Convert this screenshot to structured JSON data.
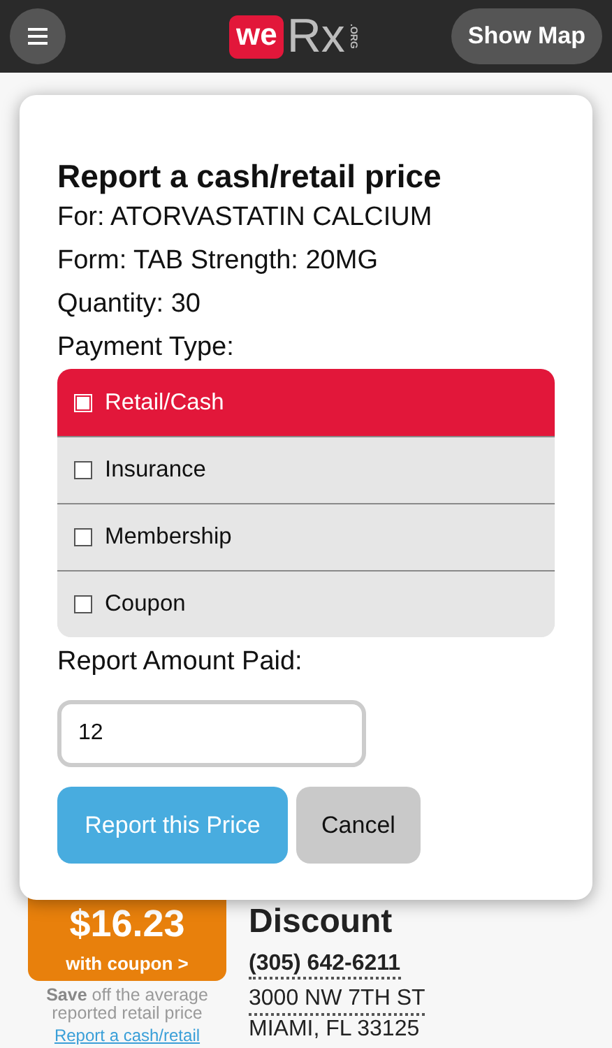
{
  "header": {
    "logo": {
      "we": "we",
      "rx": "Rx",
      "org": ".ORG"
    },
    "show_map": "Show Map"
  },
  "background": {
    "price": "$16.23",
    "coupon": "with coupon >",
    "save_note": "**Save** off the average reported retail price",
    "report_link": "Report a cash/retail",
    "heading": "Discount",
    "phone": "(305) 642-6211",
    "address_1": "3000 NW 7TH ST",
    "address_2": "MIAMI, FL 33125"
  },
  "dialog": {
    "title": "Report a cash/retail price",
    "lines": [
      "For: ATORVASTATIN CALCIUM",
      "Form: TAB Strength: 20MG",
      "Quantity: 30"
    ],
    "payment_label": "Payment Type:",
    "payment_options": [
      {
        "label": "Retail/Cash",
        "selected": true
      },
      {
        "label": "Insurance",
        "selected": false
      },
      {
        "label": "Membership",
        "selected": false
      },
      {
        "label": "Coupon",
        "selected": false
      }
    ],
    "amount_label": "Report Amount Paid:",
    "amount_value": "12",
    "submit": "Report this Price",
    "cancel": "Cancel"
  }
}
